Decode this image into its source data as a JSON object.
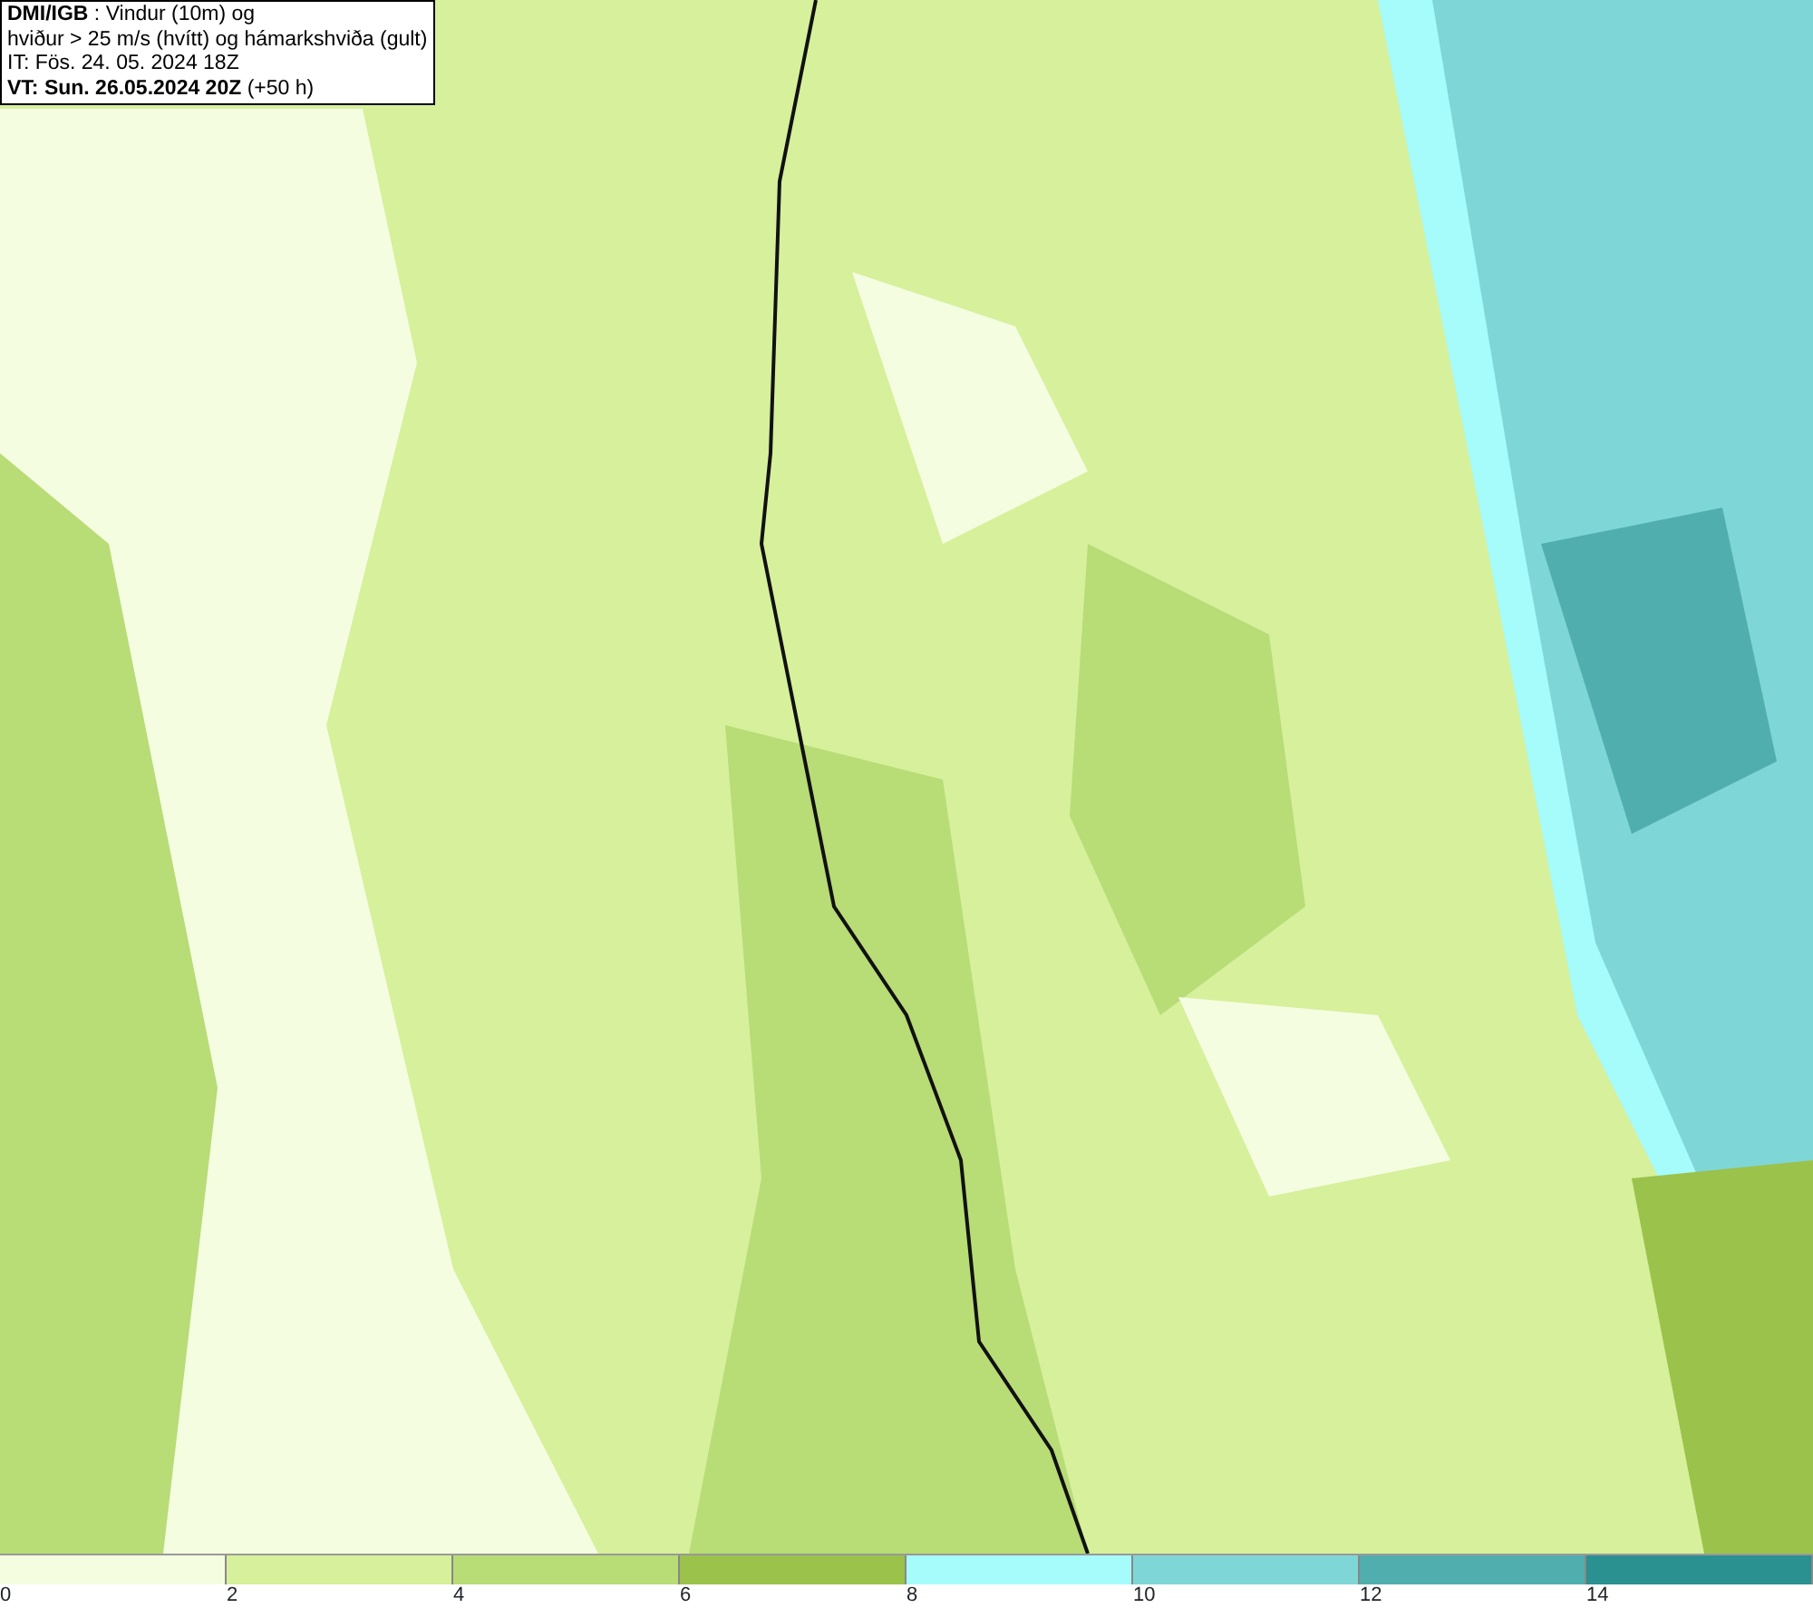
{
  "header": {
    "lines": [
      "**DMI/IGB** : Vindur (10m) og",
      "hviður > 25 m/s (hvítt) og hámarkshviða (gult)",
      "IT: Fös. 24. 05. 2024 18Z",
      "**VT: Sun. 26.05.2024 20Z** (+50 h)"
    ]
  },
  "legend": {
    "bins": [
      {
        "color": "#f5fde0"
      },
      {
        "color": "#d6f09c"
      },
      {
        "color": "#b8dc76"
      },
      {
        "color": "#9bc24a"
      },
      {
        "color": "#a6fbfb"
      },
      {
        "color": "#7fd6d6"
      },
      {
        "color": "#50aeae"
      },
      {
        "color": "#2a9090"
      }
    ],
    "labels": [
      "0",
      "2",
      "4",
      "6",
      "8",
      "10",
      "12",
      "14"
    ]
  }
}
